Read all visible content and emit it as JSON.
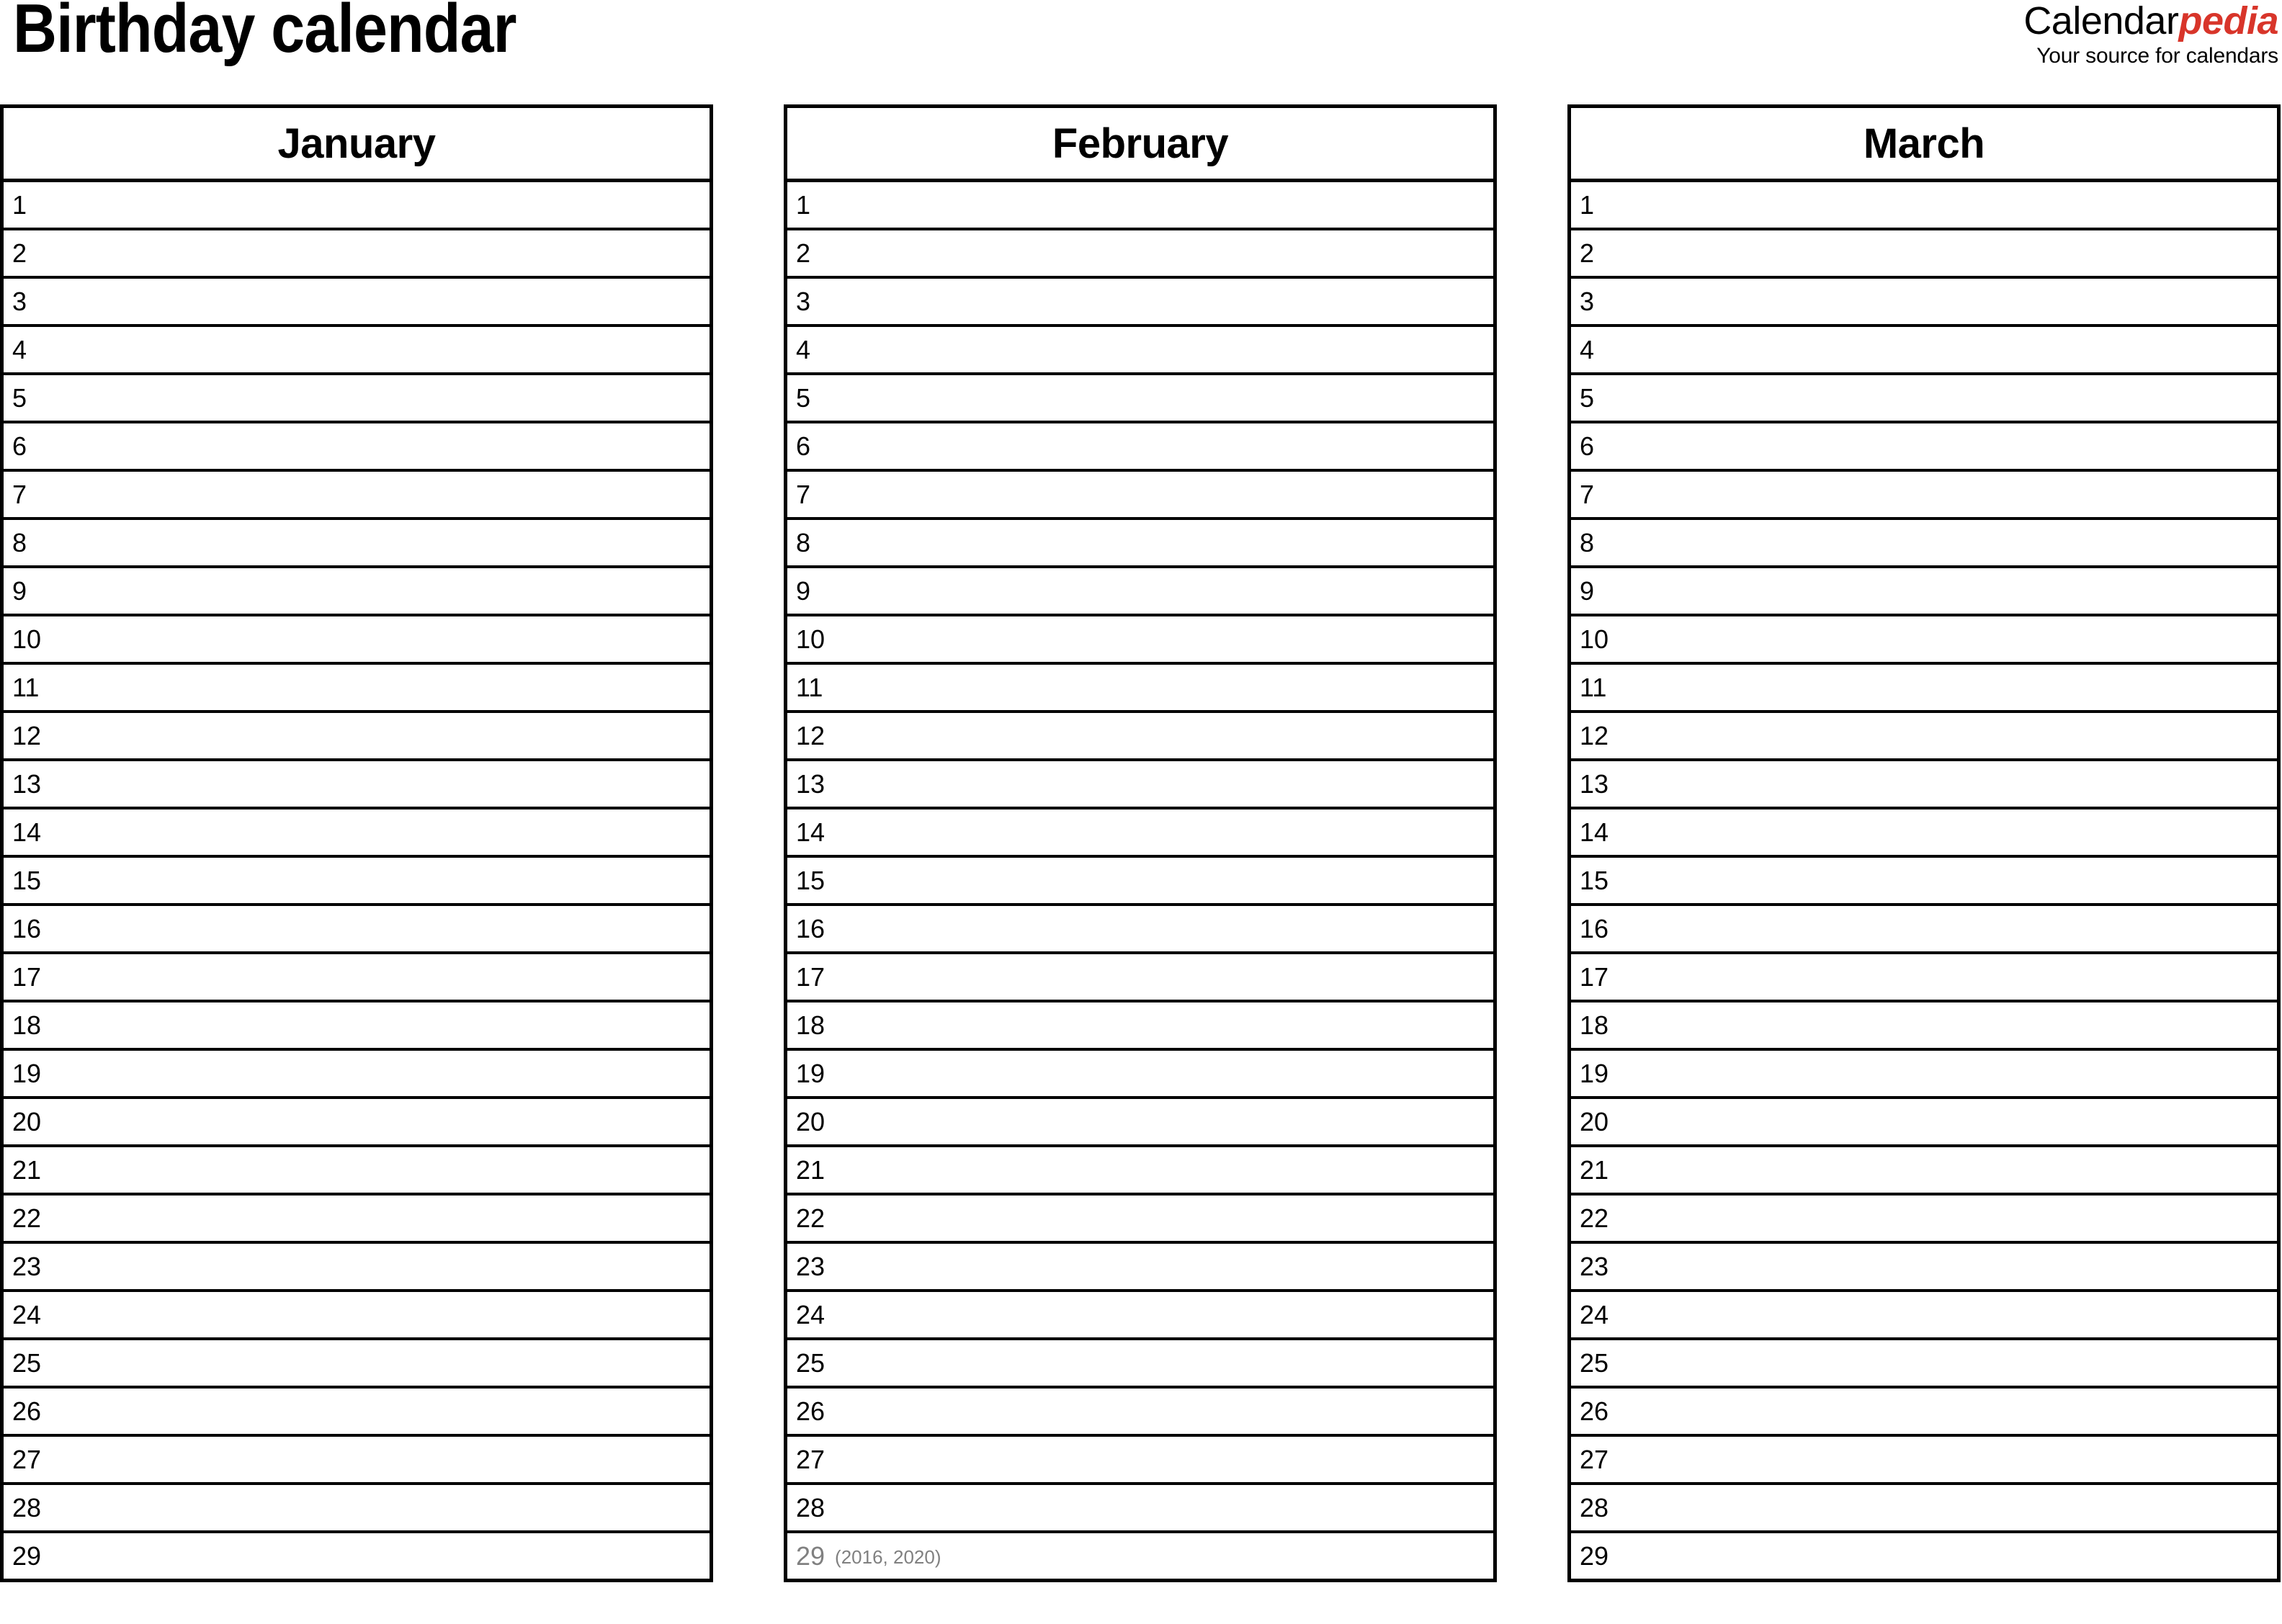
{
  "document": {
    "title": "Birthday calendar"
  },
  "brand": {
    "name_primary": "Calendar",
    "name_accent": "pedia",
    "tagline": "Your source for calendars",
    "accent_color": "#d8352a"
  },
  "colors": {
    "text": "#000000",
    "muted": "#808080",
    "border": "#000000",
    "background": "#ffffff"
  },
  "months": [
    {
      "name": "January",
      "days": [
        {
          "num": "1"
        },
        {
          "num": "2"
        },
        {
          "num": "3"
        },
        {
          "num": "4"
        },
        {
          "num": "5"
        },
        {
          "num": "6"
        },
        {
          "num": "7"
        },
        {
          "num": "8"
        },
        {
          "num": "9"
        },
        {
          "num": "10"
        },
        {
          "num": "11"
        },
        {
          "num": "12"
        },
        {
          "num": "13"
        },
        {
          "num": "14"
        },
        {
          "num": "15"
        },
        {
          "num": "16"
        },
        {
          "num": "17"
        },
        {
          "num": "18"
        },
        {
          "num": "19"
        },
        {
          "num": "20"
        },
        {
          "num": "21"
        },
        {
          "num": "22"
        },
        {
          "num": "23"
        },
        {
          "num": "24"
        },
        {
          "num": "25"
        },
        {
          "num": "26"
        },
        {
          "num": "27"
        },
        {
          "num": "28"
        },
        {
          "num": "29"
        }
      ]
    },
    {
      "name": "February",
      "days": [
        {
          "num": "1"
        },
        {
          "num": "2"
        },
        {
          "num": "3"
        },
        {
          "num": "4"
        },
        {
          "num": "5"
        },
        {
          "num": "6"
        },
        {
          "num": "7"
        },
        {
          "num": "8"
        },
        {
          "num": "9"
        },
        {
          "num": "10"
        },
        {
          "num": "11"
        },
        {
          "num": "12"
        },
        {
          "num": "13"
        },
        {
          "num": "14"
        },
        {
          "num": "15"
        },
        {
          "num": "16"
        },
        {
          "num": "17"
        },
        {
          "num": "18"
        },
        {
          "num": "19"
        },
        {
          "num": "20"
        },
        {
          "num": "21"
        },
        {
          "num": "22"
        },
        {
          "num": "23"
        },
        {
          "num": "24"
        },
        {
          "num": "25"
        },
        {
          "num": "26"
        },
        {
          "num": "27"
        },
        {
          "num": "28"
        },
        {
          "num": "29",
          "note": "(2016, 2020)",
          "muted": true
        }
      ]
    },
    {
      "name": "March",
      "days": [
        {
          "num": "1"
        },
        {
          "num": "2"
        },
        {
          "num": "3"
        },
        {
          "num": "4"
        },
        {
          "num": "5"
        },
        {
          "num": "6"
        },
        {
          "num": "7"
        },
        {
          "num": "8"
        },
        {
          "num": "9"
        },
        {
          "num": "10"
        },
        {
          "num": "11"
        },
        {
          "num": "12"
        },
        {
          "num": "13"
        },
        {
          "num": "14"
        },
        {
          "num": "15"
        },
        {
          "num": "16"
        },
        {
          "num": "17"
        },
        {
          "num": "18"
        },
        {
          "num": "19"
        },
        {
          "num": "20"
        },
        {
          "num": "21"
        },
        {
          "num": "22"
        },
        {
          "num": "23"
        },
        {
          "num": "24"
        },
        {
          "num": "25"
        },
        {
          "num": "26"
        },
        {
          "num": "27"
        },
        {
          "num": "28"
        },
        {
          "num": "29"
        }
      ]
    }
  ]
}
